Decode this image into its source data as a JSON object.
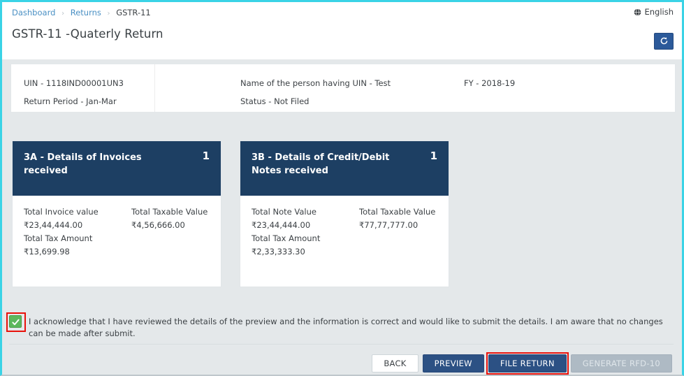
{
  "breadcrumb": {
    "items": [
      {
        "label": "Dashboard",
        "link": true
      },
      {
        "label": "Returns",
        "link": true
      },
      {
        "label": "GSTR-11",
        "link": false
      }
    ],
    "separator": "›"
  },
  "header": {
    "language": "English",
    "language_icon": "globe-icon",
    "page_title": "GSTR-11 -Quaterly Return",
    "refresh_icon": "refresh-icon"
  },
  "info_bar": {
    "uin_label": "UIN - 1118IND00001UN3",
    "return_period_label": "Return Period - Jan-Mar",
    "person_name_label": "Name of the person having UIN - Test",
    "status_label": "Status - Not Filed",
    "fy_label": "FY - 2018-19"
  },
  "cards": [
    {
      "title": "3A - Details of Invoices received",
      "count": "1",
      "left_label": "Total Invoice value",
      "left_value": "₹23,44,444.00",
      "tax_label": "Total Tax Amount",
      "tax_value": "₹13,699.98",
      "right_label": "Total Taxable Value",
      "right_value": "₹4,56,666.00"
    },
    {
      "title": "3B - Details of Credit/Debit Notes received",
      "count": "1",
      "left_label": "Total Note Value",
      "left_value": "₹23,44,444.00",
      "tax_label": "Total Tax Amount",
      "tax_value": "₹2,33,333.30",
      "right_label": "Total Taxable Value",
      "right_value": "₹77,77,777.00"
    }
  ],
  "acknowledgment": {
    "checked": true,
    "text": "I acknowledge that I have reviewed the details of the preview and the information is correct and would like to submit the details. I am aware that no changes can be made after submit."
  },
  "buttons": {
    "back": "BACK",
    "preview": "PREVIEW",
    "file_return": "FILE RETURN",
    "generate_rfd": "GENERATE RFD-10"
  },
  "colors": {
    "accent_border": "#3ad3e6",
    "card_header": "#1d3f63",
    "primary_button": "#2c5184",
    "disabled_button": "#aebac4",
    "checkbox_green": "#5cb85c",
    "annotation_red": "#e8120b",
    "link_blue": "#4a90c4",
    "page_background": "#e4e8ea"
  }
}
